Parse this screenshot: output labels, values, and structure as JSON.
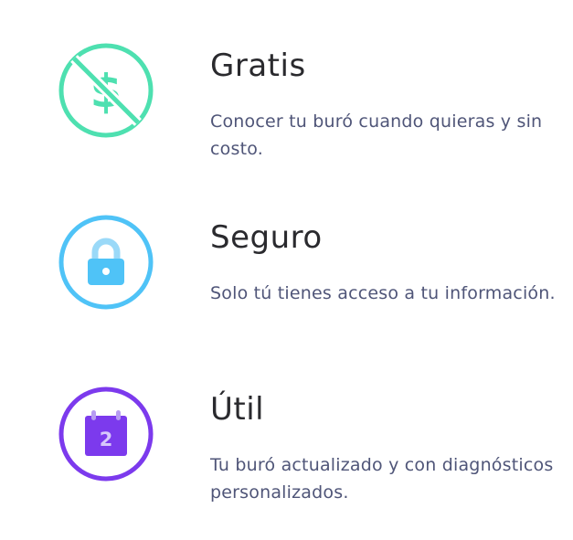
{
  "features": [
    {
      "title": "Gratis",
      "description": "Conocer tu buró cuando quieras y sin costo.",
      "icon": "no-money-icon",
      "color": "#4ee0b0"
    },
    {
      "title": "Seguro",
      "description": "Solo tú tienes acceso a tu información.",
      "icon": "lock-icon",
      "color": "#4fc3f7"
    },
    {
      "title": "Útil",
      "description": "Tu buró actualizado y con diagnósticos personalizados.",
      "icon": "calendar-icon",
      "color": "#7c3aed",
      "calendar_day": "2"
    }
  ]
}
